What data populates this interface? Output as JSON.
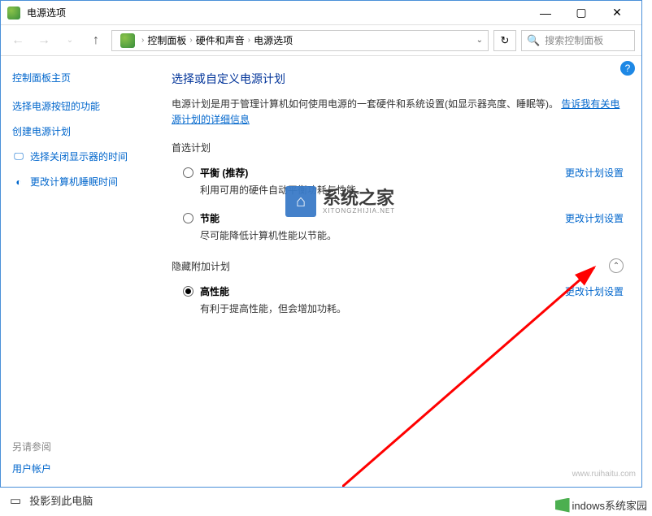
{
  "titlebar": {
    "title": "电源选项"
  },
  "toolbar": {
    "breadcrumb": [
      "控制面板",
      "硬件和声音",
      "电源选项"
    ],
    "search_placeholder": "搜索控制面板"
  },
  "sidebar": {
    "home": "控制面板主页",
    "links": [
      {
        "label": "选择电源按钮的功能",
        "icon": ""
      },
      {
        "label": "创建电源计划",
        "icon": ""
      },
      {
        "label": "选择关闭显示器的时间",
        "icon": "🖵"
      },
      {
        "label": "更改计算机睡眠时间",
        "icon": "◐"
      }
    ]
  },
  "main": {
    "title": "选择或自定义电源计划",
    "desc_pre": "电源计划是用于管理计算机如何使用电源的一套硬件和系统设置(如显示器亮度、睡眠等)。",
    "desc_link": "告诉我有关电源计划的详细信息",
    "preferred_label": "首选计划",
    "hidden_label": "隐藏附加计划",
    "change_link": "更改计划设置",
    "plans": [
      {
        "name": "平衡 (推荐)",
        "desc": "利用可用的硬件自动平衡功耗与性能。",
        "checked": false
      },
      {
        "name": "节能",
        "desc": "尽可能降低计算机性能以节能。",
        "checked": false
      }
    ],
    "hidden_plans": [
      {
        "name": "高性能",
        "desc": "有利于提高性能，但会增加功耗。",
        "checked": true
      }
    ]
  },
  "footer": {
    "see_also": "另请参阅",
    "user_accounts": "用户帐户"
  },
  "taskbar": {
    "project": "投影到此电脑"
  },
  "watermark": {
    "text": "系统之家",
    "sub": "XITONGZHIJIA.NET"
  },
  "bottom_logo": "indows系统家园",
  "ruihaitu": "www.ruihaitu.com"
}
